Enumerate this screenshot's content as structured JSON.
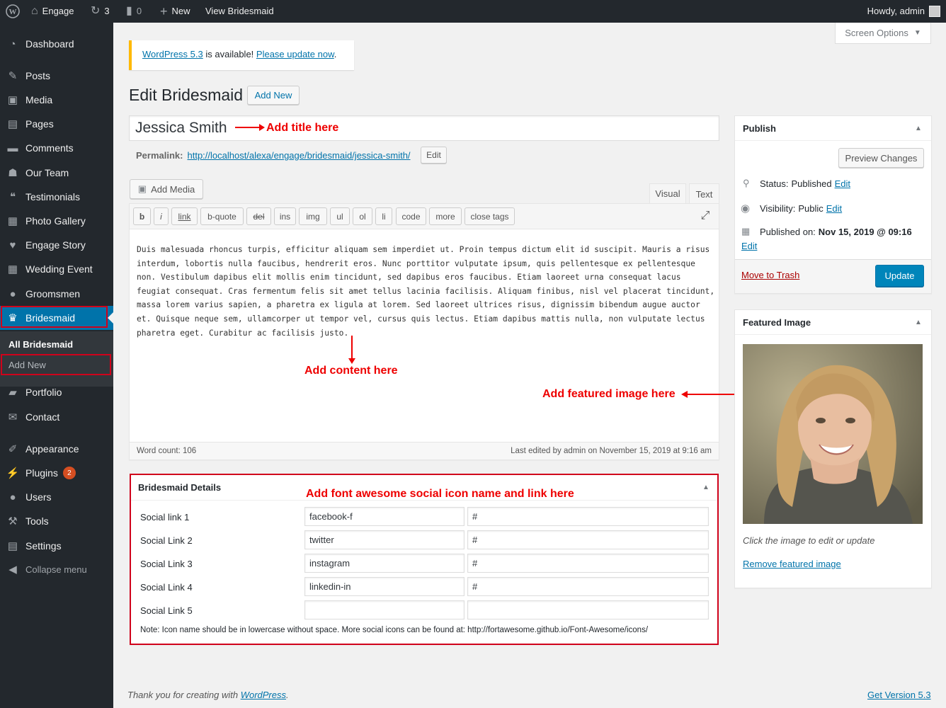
{
  "admin_bar": {
    "site_name": "Engage",
    "updates_count": "3",
    "comments_count": "0",
    "new_label": "New",
    "view_label": "View Bridesmaid",
    "howdy": "Howdy, admin"
  },
  "sidebar": {
    "items": [
      {
        "label": "Dashboard",
        "icon": "dashboard-icon"
      },
      {
        "label": "Posts",
        "icon": "pin-icon"
      },
      {
        "label": "Media",
        "icon": "media-icon"
      },
      {
        "label": "Pages",
        "icon": "pages-icon"
      },
      {
        "label": "Comments",
        "icon": "comment-icon"
      },
      {
        "label": "Our Team",
        "icon": "team-icon"
      },
      {
        "label": "Testimonials",
        "icon": "quote-icon"
      },
      {
        "label": "Photo Gallery",
        "icon": "gallery-icon"
      },
      {
        "label": "Engage Story",
        "icon": "heart-icon"
      },
      {
        "label": "Wedding Event",
        "icon": "calendar-icon"
      },
      {
        "label": "Groomsmen",
        "icon": "user-icon"
      },
      {
        "label": "Bridesmaid",
        "icon": "bridesmaid-icon"
      },
      {
        "label": "Portfolio",
        "icon": "folder-icon"
      },
      {
        "label": "Contact",
        "icon": "mail-icon"
      },
      {
        "label": "Appearance",
        "icon": "brush-icon"
      },
      {
        "label": "Plugins",
        "icon": "plugin-icon"
      },
      {
        "label": "Users",
        "icon": "users-icon"
      },
      {
        "label": "Tools",
        "icon": "wrench-icon"
      },
      {
        "label": "Settings",
        "icon": "settings-icon"
      },
      {
        "label": "Collapse menu",
        "icon": "collapse-icon"
      }
    ],
    "submenu": {
      "all": "All Bridesmaid",
      "add_new": "Add New"
    },
    "plugins_badge": "2"
  },
  "screen_options": "Screen Options",
  "notice": {
    "link1": "WordPress 5.3",
    "middle": " is available! ",
    "link2": "Please update now",
    "end": "."
  },
  "page": {
    "title": "Edit Bridesmaid",
    "add_new": "Add New"
  },
  "post": {
    "title_value": "Jessica Smith",
    "permalink_label": "Permalink:",
    "permalink_url": "http://localhost/alexa/engage/bridesmaid/jessica-smith/",
    "permalink_edit": "Edit"
  },
  "editor": {
    "add_media": "Add Media",
    "tab_visual": "Visual",
    "tab_text": "Text",
    "quicktags": [
      "b",
      "i",
      "link",
      "b-quote",
      "del",
      "ins",
      "img",
      "ul",
      "ol",
      "li",
      "code",
      "more",
      "close tags"
    ],
    "content": "Duis malesuada rhoncus turpis, efficitur aliquam sem imperdiet ut. Proin tempus dictum elit id suscipit. Mauris a risus interdum, lobortis nulla faucibus, hendrerit eros. Nunc porttitor vulputate ipsum, quis pellentesque ex pellentesque non. Vestibulum dapibus elit mollis enim tincidunt, sed dapibus eros faucibus. Etiam laoreet urna consequat lacus feugiat consequat. Cras fermentum felis sit amet tellus lacinia facilisis. Aliquam finibus, nisl vel placerat tincidunt, massa lorem varius sapien, a pharetra ex ligula at lorem. Sed laoreet ultrices risus, dignissim bibendum augue auctor et. Quisque neque sem, ullamcorper ut tempor vel, cursus quis lectus. Etiam dapibus mattis nulla, non vulputate lectus pharetra eget. Curabitur ac facilisis justo.",
    "word_count": "Word count: 106",
    "last_edited": "Last edited by admin on November 15, 2019 at 9:16 am"
  },
  "details": {
    "title": "Bridesmaid Details",
    "rows": [
      {
        "label": "Social link 1",
        "icon": "facebook-f",
        "link": "#"
      },
      {
        "label": "Social Link 2",
        "icon": "twitter",
        "link": "#"
      },
      {
        "label": "Social Link 3",
        "icon": "instagram",
        "link": "#"
      },
      {
        "label": "Social Link 4",
        "icon": "linkedin-in",
        "link": "#"
      },
      {
        "label": "Social Link 5",
        "icon": "",
        "link": ""
      }
    ],
    "note": "Note: Icon name should be in lowercase without space. More social icons can be found at: http://fortawesome.github.io/Font-Awesome/icons/"
  },
  "publish": {
    "title": "Publish",
    "preview": "Preview Changes",
    "status_label": "Status: ",
    "status_value": "Published",
    "visibility_label": "Visibility: ",
    "visibility_value": "Public",
    "published_label": "Published on: ",
    "published_value": "Nov 15, 2019 @ 09:16",
    "edit": "Edit",
    "trash": "Move to Trash",
    "update": "Update"
  },
  "featured": {
    "title": "Featured Image",
    "hint": "Click the image to edit or update",
    "remove": "Remove featured image"
  },
  "annotations": {
    "title": "Add title here",
    "content": "Add content here",
    "image": "Add featured image here",
    "social": "Add font awesome social icon name and link here"
  },
  "footer": {
    "thanks": "Thank you for creating with ",
    "wp": "WordPress",
    "dot": ".",
    "version": "Get Version 5.3"
  },
  "colors": {
    "accent": "#0073aa",
    "annotation": "#e00000",
    "sidebar": "#23282d",
    "notice": "#ffb900"
  }
}
